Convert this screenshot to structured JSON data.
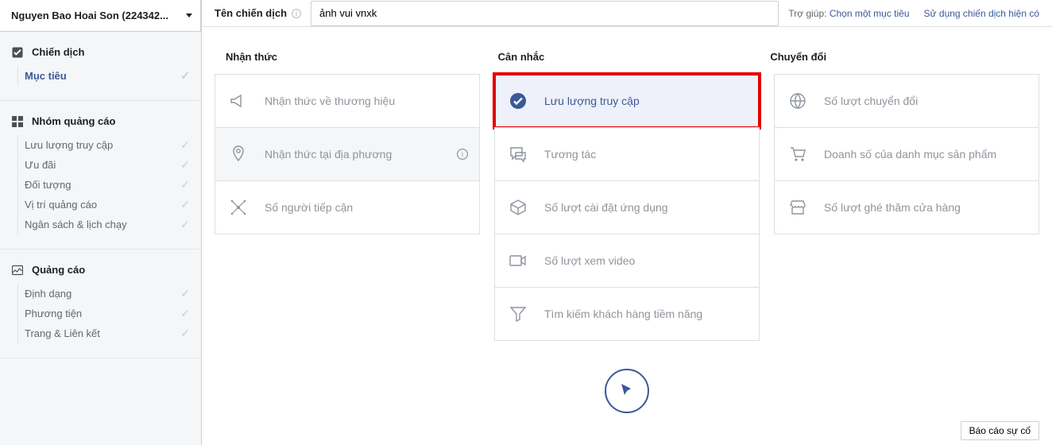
{
  "account": {
    "name": "Nguyen Bao Hoai Son (224342..."
  },
  "sidebar": {
    "section1": {
      "title": "Chiến dịch",
      "items": [
        {
          "label": "Mục tiêu",
          "active": true
        }
      ]
    },
    "section2": {
      "title": "Nhóm quảng cáo",
      "items": [
        {
          "label": "Lưu lượng truy cập"
        },
        {
          "label": "Ưu đãi"
        },
        {
          "label": "Đối tượng"
        },
        {
          "label": "Vị trí quảng cáo"
        },
        {
          "label": "Ngân sách & lịch chạy"
        }
      ]
    },
    "section3": {
      "title": "Quảng cáo",
      "items": [
        {
          "label": "Định dạng"
        },
        {
          "label": "Phương tiện"
        },
        {
          "label": "Trang & Liên kết"
        }
      ]
    }
  },
  "topbar": {
    "label": "Tên chiến dịch",
    "value": "ảnh vui vnxk",
    "help_prefix": "Trợ giúp: ",
    "help_link": "Chọn một mục tiêu",
    "use_existing": "Sử dụng chiến dịch hiện có"
  },
  "columns": [
    "Nhận thức",
    "Cân nhắc",
    "Chuyển đổi"
  ],
  "cards": {
    "col1": [
      {
        "name": "brand-awareness",
        "label": "Nhận thức về thương hiệu"
      },
      {
        "name": "local-awareness",
        "label": "Nhận thức tại địa phương",
        "info": true
      },
      {
        "name": "reach",
        "label": "Số người tiếp cận"
      }
    ],
    "col2": [
      {
        "name": "traffic",
        "label": "Lưu lượng truy cập",
        "selected": true,
        "highlight": true
      },
      {
        "name": "engagement",
        "label": "Tương tác"
      },
      {
        "name": "app-installs",
        "label": "Số lượt cài đặt ứng dụng"
      },
      {
        "name": "video-views",
        "label": "Số lượt xem video"
      },
      {
        "name": "lead-gen",
        "label": "Tìm kiếm khách hàng tiềm năng"
      }
    ],
    "col3": [
      {
        "name": "conversions",
        "label": "Số lượt chuyển đổi"
      },
      {
        "name": "catalog-sales",
        "label": "Doanh số của danh mục sản phẩm"
      },
      {
        "name": "store-visits",
        "label": "Số lượt ghé thăm cửa hàng"
      }
    ]
  },
  "report_button": "Báo cáo sự cố"
}
